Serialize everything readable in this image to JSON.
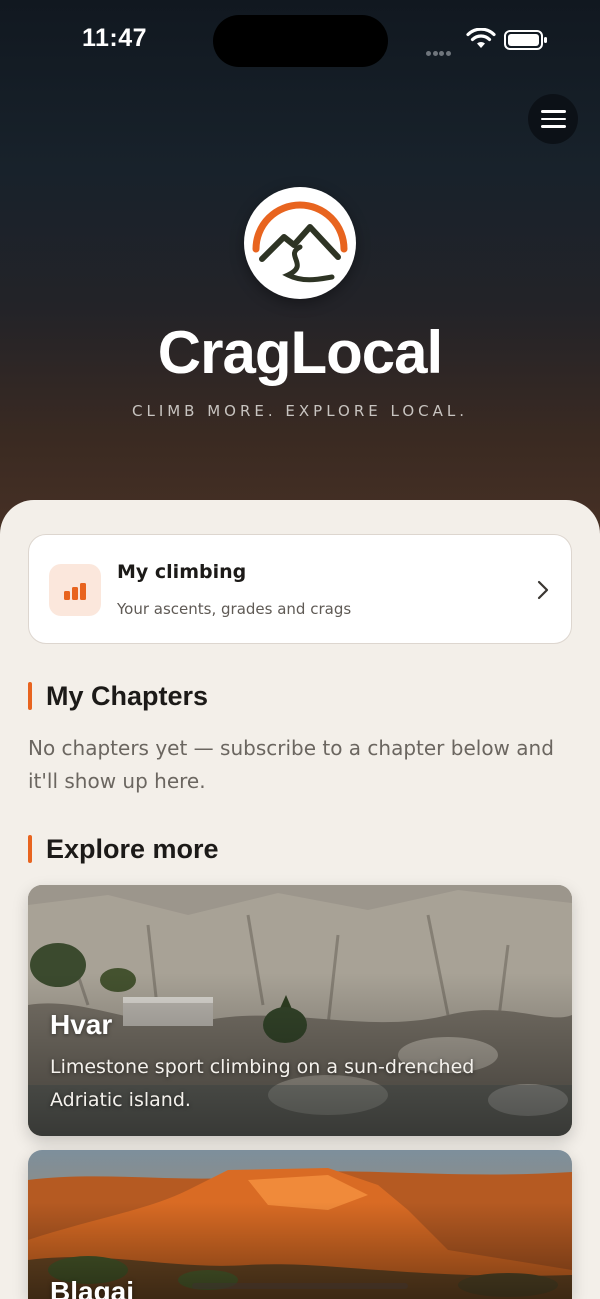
{
  "status_bar": {
    "time": "11:47"
  },
  "header": {
    "menu_icon": "hamburger-icon",
    "logo_icon": "mountain-logo-icon",
    "brand": "CragLocal",
    "tagline": "CLIMB MORE. EXPLORE LOCAL."
  },
  "my_climbing": {
    "icon": "bar-chart-icon",
    "title": "My climbing",
    "subtitle": "Your ascents, grades and crags"
  },
  "my_chapters": {
    "heading": "My Chapters",
    "empty_text": "No chapters yet — subscribe to a chapter below and it'll show up here."
  },
  "explore": {
    "heading": "Explore more",
    "cards": [
      {
        "title": "Hvar",
        "description": "Limestone sport climbing on a sun-drenched Adriatic island."
      },
      {
        "title": "Blagaj"
      }
    ]
  },
  "colors": {
    "accent": "#e8641f",
    "hero_top": "#111820",
    "hero_bottom": "#4a3225",
    "sheet_bg": "#f3efe9"
  }
}
